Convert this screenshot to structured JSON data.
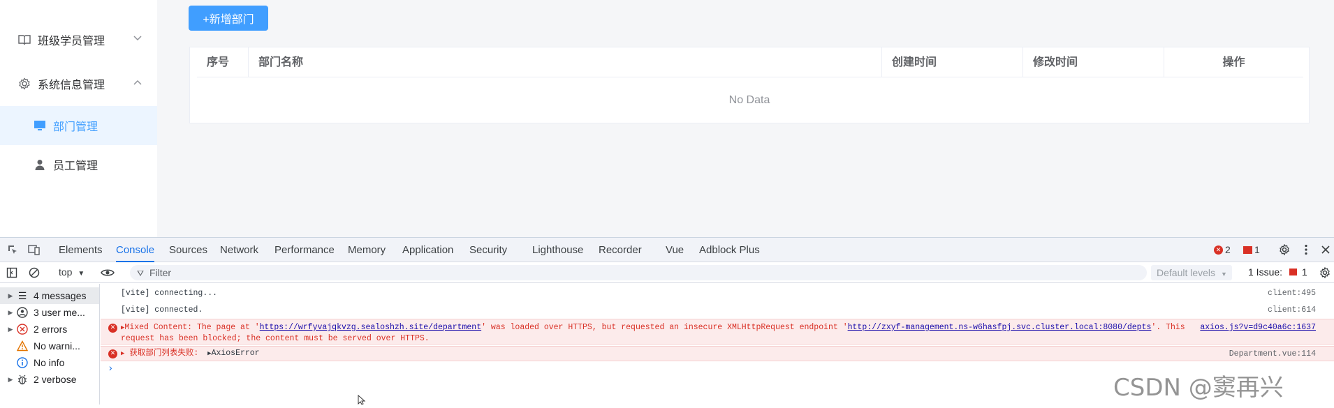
{
  "sidebar": {
    "items": [
      {
        "label": "班级学员管理",
        "icon": "book-icon",
        "arrow": "chevron-down"
      },
      {
        "label": "系统信息管理",
        "icon": "gear-icon",
        "arrow": "chevron-up"
      },
      {
        "label": "部门管理",
        "icon": "monitor-icon",
        "active": true
      },
      {
        "label": "员工管理",
        "icon": "user-icon"
      }
    ]
  },
  "main": {
    "add_button": "+新增部门",
    "table": {
      "columns": [
        "序号",
        "部门名称",
        "创建时间",
        "修改时间",
        "操作"
      ],
      "empty_text": "No Data"
    }
  },
  "devtools": {
    "tabs": [
      "Elements",
      "Console",
      "Sources",
      "Network",
      "Performance",
      "Memory",
      "Application",
      "Security",
      "Lighthouse",
      "Recorder",
      "Vue",
      "Adblock Plus"
    ],
    "active_tab": "Console",
    "error_count": "2",
    "issue_count": "1",
    "toolbar": {
      "context": "top",
      "filter_placeholder": "Filter",
      "levels": "Default levels",
      "issues_label": "1 Issue:",
      "issues_count": "1"
    },
    "message_sidebar": [
      {
        "label": "4 messages",
        "icon": "list-icon"
      },
      {
        "label": "3 user me...",
        "icon": "user-circle-icon"
      },
      {
        "label": "2 errors",
        "icon": "error-icon"
      },
      {
        "label": "No warni...",
        "icon": "warning-icon"
      },
      {
        "label": "No info",
        "icon": "info-icon"
      },
      {
        "label": "2 verbose",
        "icon": "bug-icon"
      }
    ],
    "console": {
      "log1": {
        "text": "[vite] connecting...",
        "source": "client:495"
      },
      "log2": {
        "text": "[vite] connected.",
        "source": "client:614"
      },
      "error1": {
        "prefix": "Mixed Content: The page at '",
        "page_url": "https://wrfyvajqkvzg.sealoshzh.site/department",
        "middle": "' was loaded over HTTPS, but requested an insecure XMLHttpRequest endpoint '",
        "endpoint_url": "http://zxyf-management.ns-w6hasfpj.svc.cluster.local:8080/depts",
        "suffix": "'. This",
        "line2": "request has been blocked; the content must be served over HTTPS.",
        "source": "axios.js?v=d9c40a6c:1637"
      },
      "error2": {
        "text": "获取部门列表失败:",
        "object": "AxiosError",
        "source": "Department.vue:114"
      }
    }
  },
  "watermark": "CSDN @窦再兴"
}
